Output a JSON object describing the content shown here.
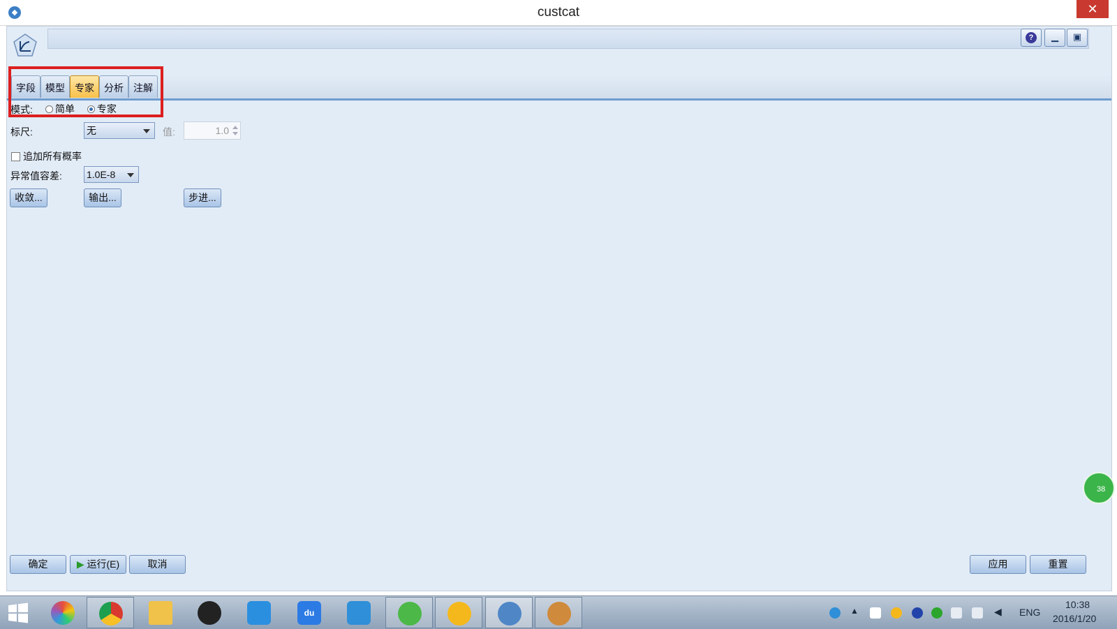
{
  "window": {
    "title": "custcat",
    "close_label": "✕"
  },
  "header": {
    "help_label": "?"
  },
  "tabs": [
    {
      "label": "字段"
    },
    {
      "label": "模型"
    },
    {
      "label": "专家",
      "active": true
    },
    {
      "label": "分析"
    },
    {
      "label": "注解"
    }
  ],
  "mode": {
    "label": "模式:",
    "options": [
      "简单",
      "专家"
    ],
    "selected": "专家"
  },
  "scale": {
    "label": "标尺:",
    "value": "无",
    "value_label": "值:",
    "value_number": "1.0"
  },
  "append_all_probabilities": {
    "label": "追加所有概率",
    "checked": false
  },
  "singularity_tolerance": {
    "label": "异常值容差:",
    "value": "1.0E-8"
  },
  "buttons": {
    "convergence": "收敛...",
    "output": "输出...",
    "stepping": "步进...",
    "ok": "确定",
    "run": "运行(E)",
    "cancel": "取消",
    "apply": "应用",
    "reset": "重置"
  },
  "float_badge": {
    "text": "38"
  },
  "taskbar": {
    "items": [
      {
        "icon": "chrome-icon",
        "color": "#d93a2f"
      },
      {
        "icon": "file-explorer-icon",
        "color": "#f0c24a"
      },
      {
        "icon": "qq-icon",
        "color": "#222222"
      },
      {
        "icon": "baidu-cloud-icon",
        "color": "#2b8fe0"
      },
      {
        "icon": "baidu-du-icon",
        "color": "#2c7be5"
      },
      {
        "icon": "app-icon",
        "color": "#2f8fd8"
      },
      {
        "icon": "wechat-icon",
        "color": "#4cb848"
      },
      {
        "icon": "emoji-icon",
        "color": "#f5b81c"
      },
      {
        "icon": "spss-modeler-icon",
        "color": "#4f86c6"
      },
      {
        "icon": "paint-icon",
        "color": "#cf8a3c"
      }
    ],
    "tray": {
      "language": "ENG",
      "time": "10:38",
      "date": "2016/1/20"
    }
  }
}
